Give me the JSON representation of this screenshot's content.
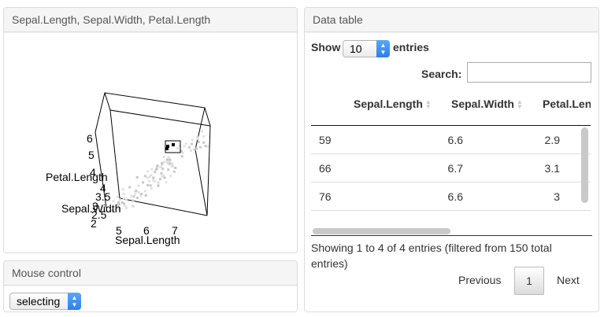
{
  "plot_panel": {
    "title": "Sepal.Length, Sepal.Width, Petal.Length",
    "axes": {
      "x_label": "Sepal.Length",
      "x_ticks": [
        "5",
        "6",
        "7"
      ],
      "y_label": "Sepal.Width",
      "y_ticks": [
        "2",
        "2.5",
        "3",
        "3.5",
        "4"
      ],
      "z_label": "Petal.Length",
      "z_ticks": [
        "4",
        "5",
        "6"
      ]
    }
  },
  "mouse_panel": {
    "title": "Mouse control",
    "mode_value": "selecting"
  },
  "table_panel": {
    "title": "Data table",
    "show_label": "Show",
    "length_value": "10",
    "entries_label": "entries",
    "search_label": "Search:",
    "search_value": "",
    "columns": [
      "Sepal.Length",
      "Sepal.Width",
      "Petal.Len"
    ],
    "rows": [
      [
        "59",
        "6.6",
        "2.9"
      ],
      [
        "66",
        "6.7",
        "3.1"
      ],
      [
        "76",
        "6.6",
        "3"
      ],
      [
        "",
        "",
        ""
      ]
    ],
    "info": "Showing 1 to 4 of 4 entries (filtered from 150 total entries)",
    "pagination": {
      "previous": "Previous",
      "current_page": "1",
      "next": "Next"
    }
  },
  "colors": {
    "select_accent": "#2f7fe6",
    "panel_header": "#f5f5f5",
    "selected_point": "#000000",
    "unselected_point": "#c8c8c8"
  }
}
